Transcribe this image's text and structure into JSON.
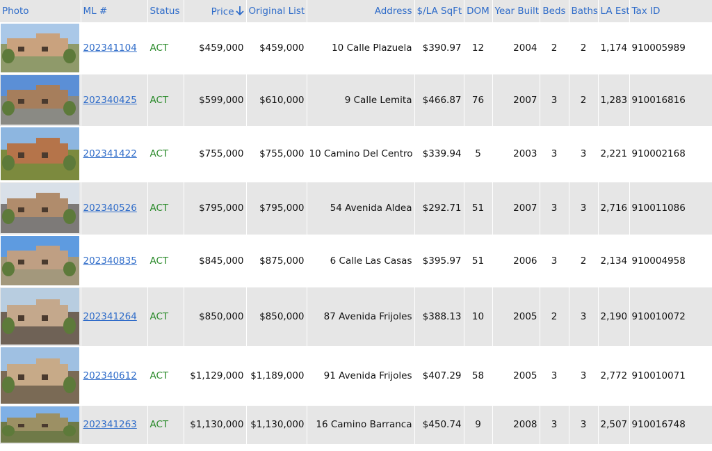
{
  "columns": {
    "photo": "Photo",
    "ml": "ML #",
    "status": "Status",
    "price": "Price",
    "original_list": "Original List",
    "address": "Address",
    "price_per_sqft": "$/LA SqFt",
    "dom": "DOM",
    "year_built": "Year Built",
    "beds": "Beds",
    "baths": "Baths",
    "la_est": "LA Est",
    "tax_id": "Tax ID"
  },
  "sort": {
    "column": "price",
    "direction": "descending-arrow"
  },
  "colors": {
    "header_text": "#2f6cc9",
    "status_text": "#2a8a2a",
    "row_alt": "#e6e6e6"
  },
  "rows": [
    {
      "photo": {
        "sky": "#aac8e8",
        "wall": "#c9a27e",
        "ground": "#8f9a6a"
      },
      "ml": "202341104",
      "status": "ACT",
      "price": "$459,000",
      "original_list": "$459,000",
      "address": "10 Calle Plazuela",
      "price_per_sqft": "$390.97",
      "dom": "12",
      "year_built": "2004",
      "beds": "2",
      "baths": "2",
      "la_est": "1,174",
      "tax_id": "910005989"
    },
    {
      "photo": {
        "sky": "#5b8fd6",
        "wall": "#a67e5c",
        "ground": "#8a8a84"
      },
      "ml": "202340425",
      "status": "ACT",
      "price": "$599,000",
      "original_list": "$610,000",
      "address": "9 Calle Lemita",
      "price_per_sqft": "$466.87",
      "dom": "76",
      "year_built": "2007",
      "beds": "3",
      "baths": "2",
      "la_est": "1,283",
      "tax_id": "910016816"
    },
    {
      "photo": {
        "sky": "#8db6e0",
        "wall": "#b5744a",
        "ground": "#7c8a3e"
      },
      "ml": "202341422",
      "status": "ACT",
      "price": "$755,000",
      "original_list": "$755,000",
      "address": "10 Camino Del Centro",
      "price_per_sqft": "$339.94",
      "dom": "5",
      "year_built": "2003",
      "beds": "3",
      "baths": "3",
      "la_est": "2,221",
      "tax_id": "910002168"
    },
    {
      "photo": {
        "sky": "#d9e0e8",
        "wall": "#b08c6c",
        "ground": "#7d7a78"
      },
      "ml": "202340526",
      "status": "ACT",
      "price": "$795,000",
      "original_list": "$795,000",
      "address": "54 Avenida Aldea",
      "price_per_sqft": "$292.71",
      "dom": "51",
      "year_built": "2007",
      "beds": "3",
      "baths": "3",
      "la_est": "2,716",
      "tax_id": "910011086"
    },
    {
      "photo": {
        "sky": "#5e9be0",
        "wall": "#bf9f83",
        "ground": "#a3987c"
      },
      "ml": "202340835",
      "status": "ACT",
      "price": "$845,000",
      "original_list": "$875,000",
      "address": "6 Calle Las Casas",
      "price_per_sqft": "$395.97",
      "dom": "51",
      "year_built": "2006",
      "beds": "3",
      "baths": "2",
      "la_est": "2,134",
      "tax_id": "910004958"
    },
    {
      "photo": {
        "sky": "#b8cde0",
        "wall": "#c4a88c",
        "ground": "#6f6256"
      },
      "ml": "202341264",
      "status": "ACT",
      "price": "$850,000",
      "original_list": "$850,000",
      "address": "87 Avenida Frijoles",
      "price_per_sqft": "$388.13",
      "dom": "10",
      "year_built": "2005",
      "beds": "2",
      "baths": "3",
      "la_est": "2,190",
      "tax_id": "910010072"
    },
    {
      "photo": {
        "sky": "#9fc0e2",
        "wall": "#c7aa88",
        "ground": "#7a6a55"
      },
      "ml": "202340612",
      "status": "ACT",
      "price": "$1,129,000",
      "original_list": "$1,189,000",
      "address": "91 Avenida Frijoles",
      "price_per_sqft": "$407.29",
      "dom": "58",
      "year_built": "2005",
      "beds": "3",
      "baths": "3",
      "la_est": "2,772",
      "tax_id": "910010071"
    },
    {
      "photo": {
        "sky": "#7fb0e6",
        "wall": "#9c9064",
        "ground": "#6f7a48"
      },
      "ml": "202341263",
      "status": "ACT",
      "price": "$1,130,000",
      "original_list": "$1,130,000",
      "address": "16 Camino Barranca",
      "price_per_sqft": "$450.74",
      "dom": "9",
      "year_built": "2008",
      "beds": "3",
      "baths": "3",
      "la_est": "2,507",
      "tax_id": "910016748"
    }
  ]
}
